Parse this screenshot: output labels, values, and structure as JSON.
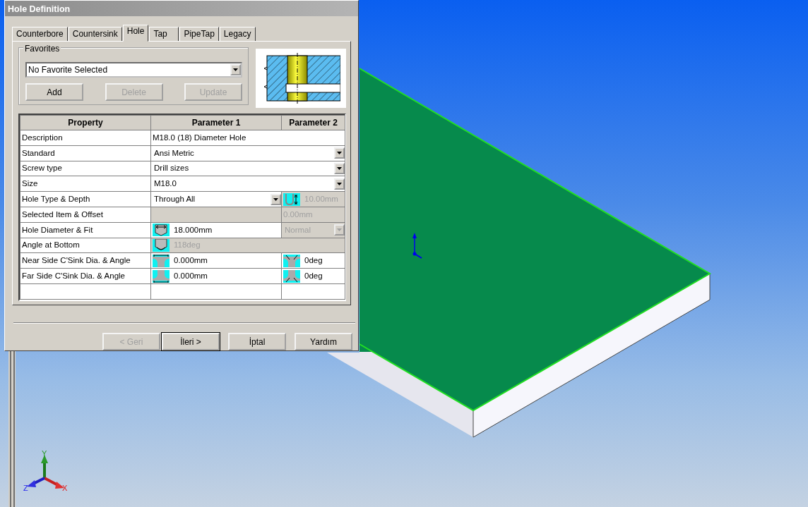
{
  "window": {
    "title": "Hole Definition"
  },
  "tabs": [
    {
      "label": "Counterbore",
      "selected": false
    },
    {
      "label": "Countersink",
      "selected": false
    },
    {
      "label": "Hole",
      "selected": true
    },
    {
      "label": "Tap",
      "selected": false
    },
    {
      "label": "PipeTap",
      "selected": false
    },
    {
      "label": "Legacy",
      "selected": false
    }
  ],
  "favorites": {
    "legend": "Favorites",
    "select_value": "No Favorite Selected",
    "buttons": [
      {
        "label": "Add",
        "disabled": false
      },
      {
        "label": "Delete",
        "disabled": true
      },
      {
        "label": "Update",
        "disabled": true
      }
    ]
  },
  "table": {
    "columns": [
      "Property",
      "Parameter 1",
      "Parameter 2"
    ],
    "rows": [
      {
        "kind": "data",
        "property": "Description",
        "cells": [
          {
            "kind": "text",
            "text": "M18.0 (18) Diameter Hole",
            "disabled": false
          }
        ]
      },
      {
        "kind": "data",
        "property": "Standard",
        "cells": [
          {
            "kind": "dropdown",
            "text": "Ansi Metric",
            "disabled": false
          }
        ]
      },
      {
        "kind": "data",
        "property": "Screw type",
        "cells": [
          {
            "kind": "dropdown",
            "text": "Drill sizes",
            "disabled": false
          }
        ]
      },
      {
        "kind": "data",
        "property": "Size",
        "cells": [
          {
            "kind": "dropdown",
            "text": "M18.0",
            "disabled": false
          }
        ]
      },
      {
        "kind": "data",
        "property": "Hole Type & Depth",
        "cells": [
          {
            "kind": "dropdown",
            "text": "Through All",
            "disabled": false
          },
          {
            "kind": "icon-text",
            "text": "10.00mm",
            "disabled": true
          }
        ]
      },
      {
        "kind": "data",
        "property": "Selected Item & Offset",
        "cells": [
          {
            "kind": "blank",
            "disabled": true
          },
          {
            "kind": "text",
            "text": "0.00mm",
            "disabled": true
          }
        ]
      },
      {
        "kind": "data",
        "property": "Hole Diameter & Fit",
        "cells": [
          {
            "kind": "icon-text",
            "text": "18.000mm",
            "disabled": false
          },
          {
            "kind": "dropdown",
            "text": "Normal",
            "disabled": true
          }
        ]
      },
      {
        "kind": "data",
        "property": "Angle at Bottom",
        "cells": [
          {
            "kind": "icon-text",
            "text": "118deg",
            "disabled": true
          }
        ]
      },
      {
        "kind": "data",
        "property": "Near Side C'Sink Dia. & Angle",
        "cells": [
          {
            "kind": "icon-text",
            "text": "0.000mm",
            "disabled": false
          },
          {
            "kind": "icon-text",
            "text": "0deg",
            "disabled": false
          }
        ]
      },
      {
        "kind": "data",
        "property": "Far Side C'Sink Dia. & Angle",
        "cells": [
          {
            "kind": "icon-text",
            "text": "0.000mm",
            "disabled": false
          },
          {
            "kind": "icon-text",
            "text": "0deg",
            "disabled": false
          }
        ]
      },
      {
        "kind": "blank"
      }
    ]
  },
  "buttons": [
    {
      "label": "< Geri",
      "disabled": true,
      "default": false
    },
    {
      "label": "İleri >",
      "disabled": false,
      "default": true
    },
    {
      "label": "İptal",
      "disabled": false,
      "default": false
    },
    {
      "label": "Yardım",
      "disabled": false,
      "default": false
    }
  ],
  "triad": {
    "x_label": "X",
    "y_label": "Y",
    "z_label": "Z"
  }
}
